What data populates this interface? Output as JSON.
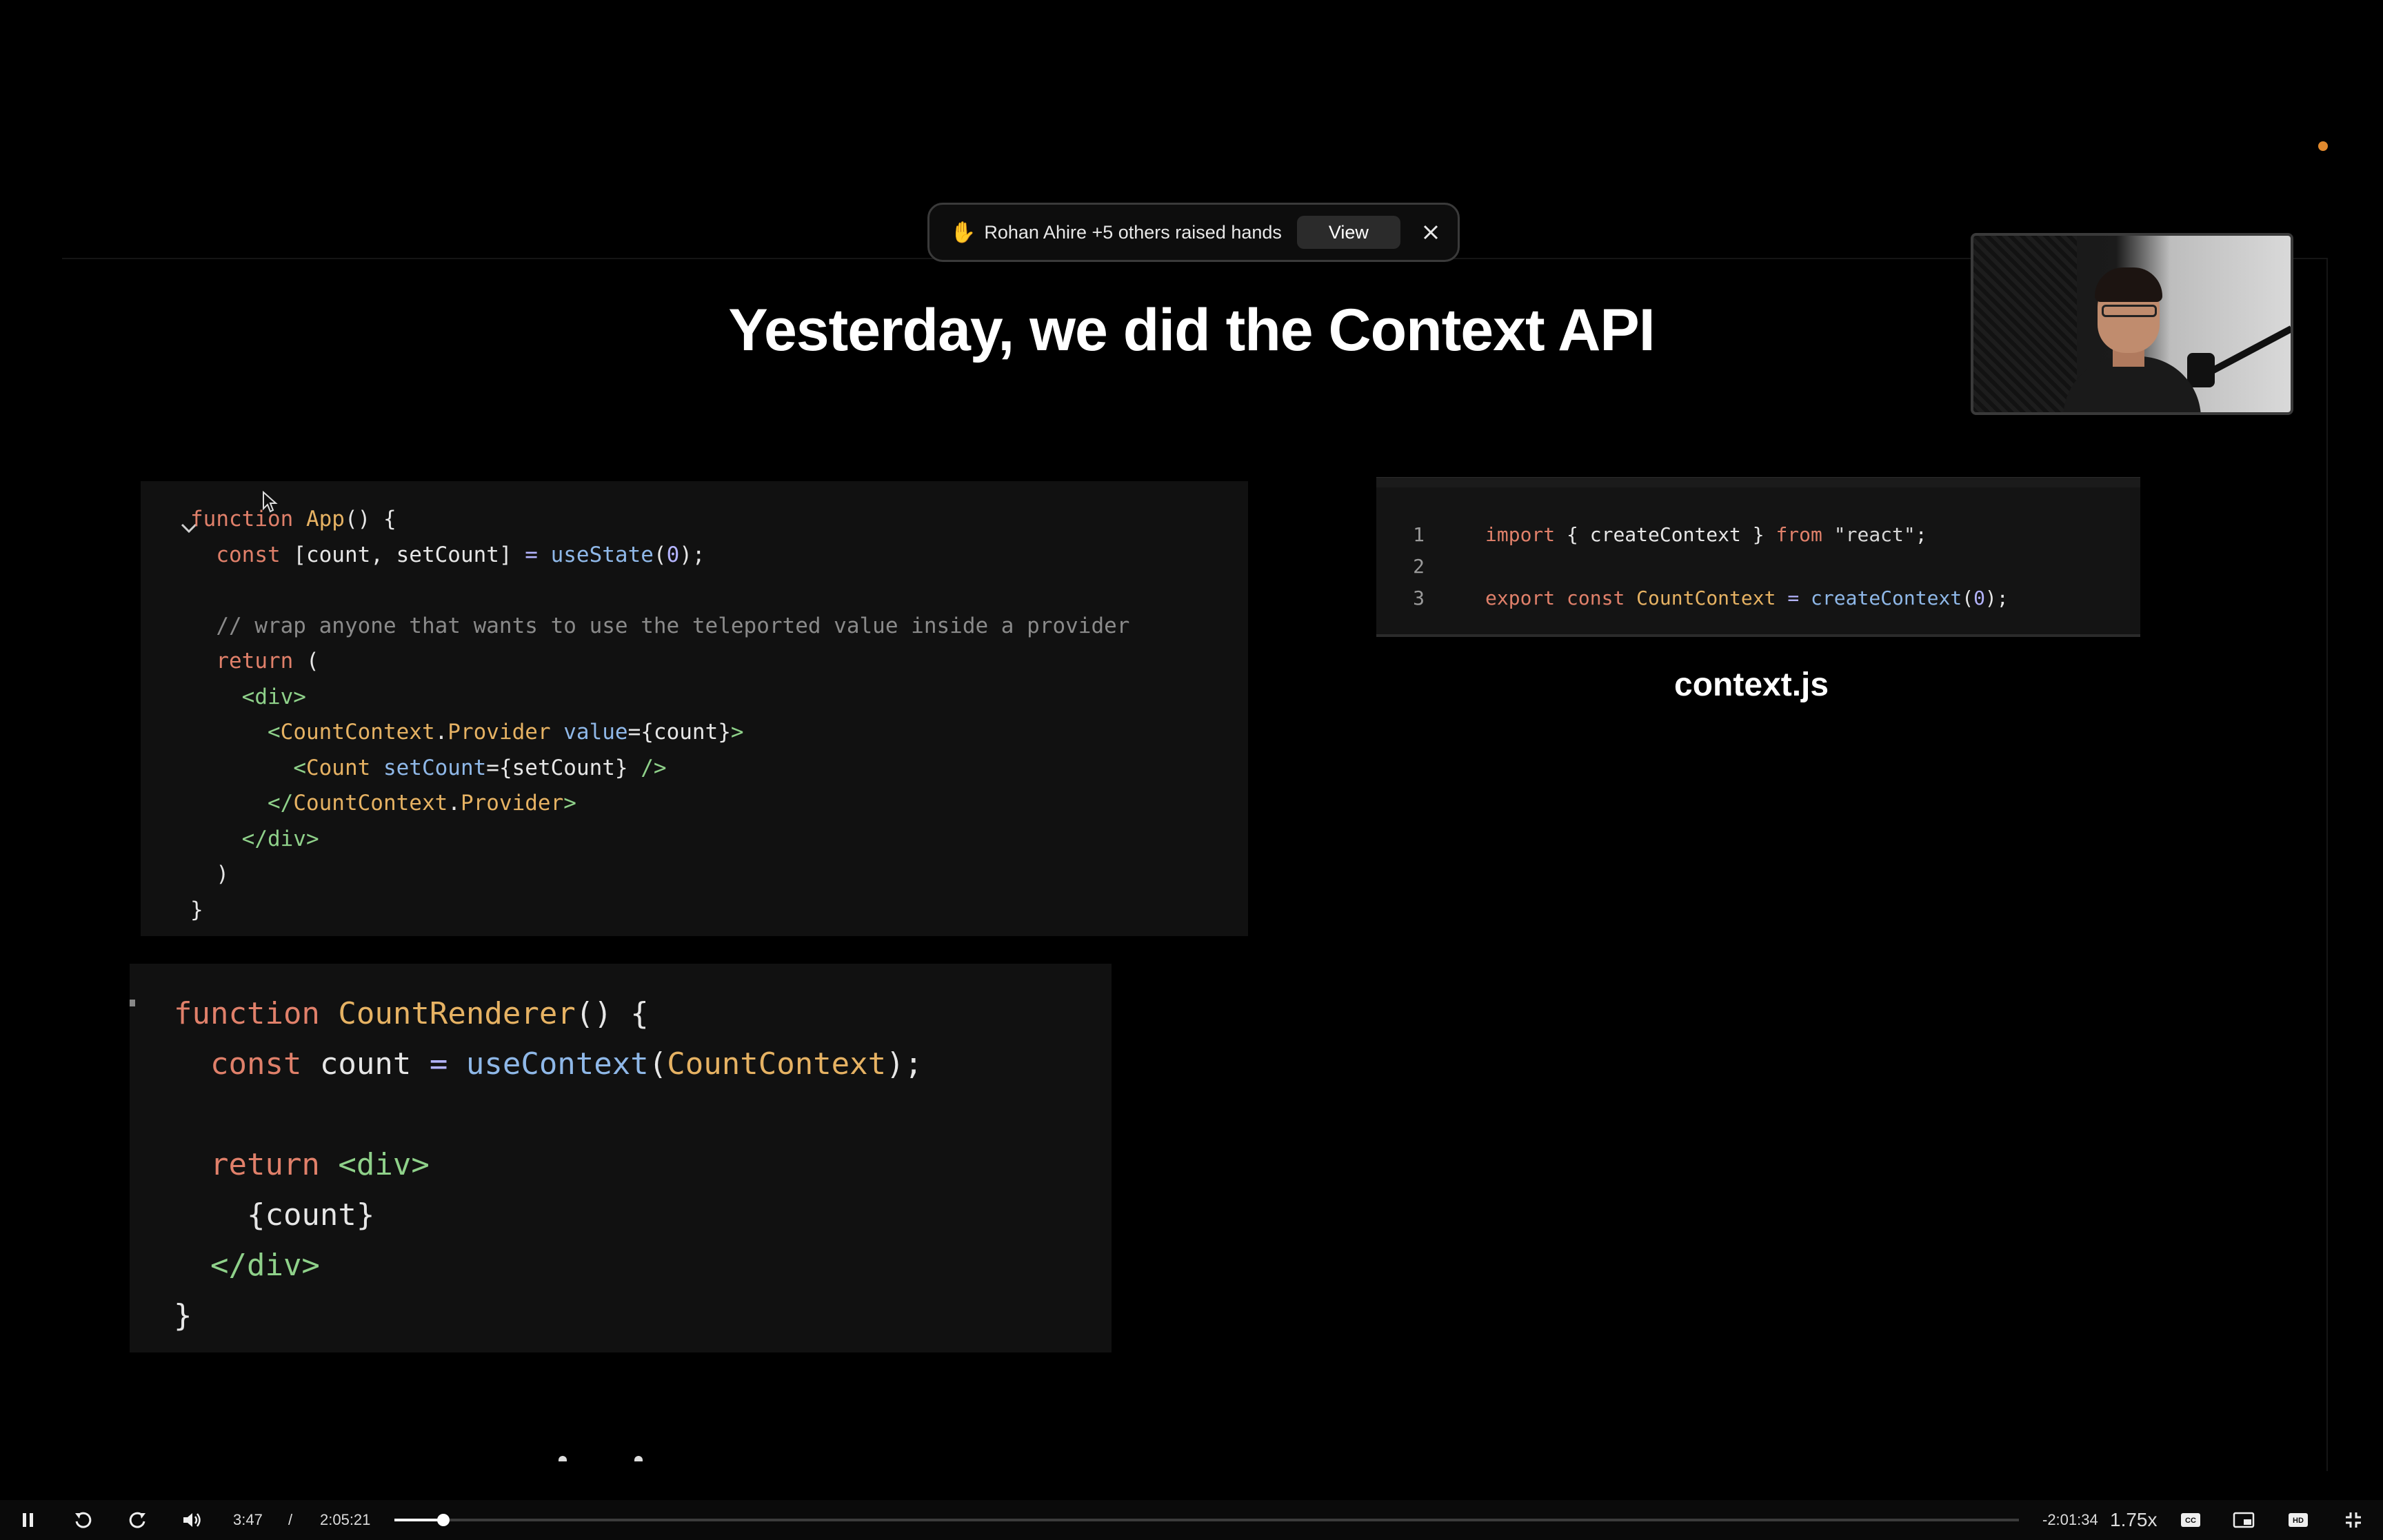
{
  "notification": {
    "message": "Rohan Ahire +5 others raised hands",
    "view_label": "View"
  },
  "slide": {
    "title": "Yesterday, we did the Context API",
    "context_caption": "context.js"
  },
  "code_app": [
    [
      {
        "t": "function ",
        "c": "kw"
      },
      {
        "t": "App",
        "c": "fn"
      },
      {
        "t": "() {",
        "c": "pl"
      }
    ],
    [
      {
        "t": "  const ",
        "c": "kw"
      },
      {
        "t": "[count, setCount] ",
        "c": "pl"
      },
      {
        "t": "= ",
        "c": "op"
      },
      {
        "t": "useState",
        "c": "attr"
      },
      {
        "t": "(",
        "c": "pl"
      },
      {
        "t": "0",
        "c": "num"
      },
      {
        "t": ");",
        "c": "pl"
      }
    ],
    [],
    [
      {
        "t": "  // wrap anyone that wants to use the teleported value inside a provider",
        "c": "cm"
      }
    ],
    [
      {
        "t": "  return ",
        "c": "kw"
      },
      {
        "t": "(",
        "c": "pl"
      }
    ],
    [
      {
        "t": "    ",
        "c": "pl"
      },
      {
        "t": "<div>",
        "c": "tag"
      }
    ],
    [
      {
        "t": "      ",
        "c": "pl"
      },
      {
        "t": "<",
        "c": "tag"
      },
      {
        "t": "CountContext",
        "c": "fn"
      },
      {
        "t": ".",
        "c": "pl"
      },
      {
        "t": "Provider",
        "c": "fn"
      },
      {
        "t": " value",
        "c": "attr"
      },
      {
        "t": "={count}",
        "c": "pl"
      },
      {
        "t": ">",
        "c": "tag"
      }
    ],
    [
      {
        "t": "        ",
        "c": "pl"
      },
      {
        "t": "<",
        "c": "tag"
      },
      {
        "t": "Count",
        "c": "fn"
      },
      {
        "t": " setCount",
        "c": "attr"
      },
      {
        "t": "={setCount} ",
        "c": "pl"
      },
      {
        "t": "/>",
        "c": "tag"
      }
    ],
    [
      {
        "t": "      ",
        "c": "pl"
      },
      {
        "t": "</",
        "c": "tag"
      },
      {
        "t": "CountContext",
        "c": "fn"
      },
      {
        "t": ".",
        "c": "pl"
      },
      {
        "t": "Provider",
        "c": "fn"
      },
      {
        "t": ">",
        "c": "tag"
      }
    ],
    [
      {
        "t": "    ",
        "c": "pl"
      },
      {
        "t": "</div>",
        "c": "tag"
      }
    ],
    [
      {
        "t": "  )",
        "c": "pl"
      }
    ],
    [
      {
        "t": "}",
        "c": "pl"
      }
    ]
  ],
  "code_context": {
    "line_numbers": [
      "1",
      "2",
      "3"
    ],
    "lines": [
      [
        {
          "t": "import ",
          "c": "kw"
        },
        {
          "t": "{ createContext } ",
          "c": "pl"
        },
        {
          "t": "from ",
          "c": "kw"
        },
        {
          "t": "\"react\"",
          "c": "str"
        },
        {
          "t": ";",
          "c": "pl"
        }
      ],
      [],
      [
        {
          "t": "export ",
          "c": "kw"
        },
        {
          "t": "const ",
          "c": "kw"
        },
        {
          "t": "CountContext ",
          "c": "fn"
        },
        {
          "t": "= ",
          "c": "op"
        },
        {
          "t": "createContext",
          "c": "attr"
        },
        {
          "t": "(",
          "c": "pl"
        },
        {
          "t": "0",
          "c": "num"
        },
        {
          "t": ");",
          "c": "pl"
        }
      ]
    ]
  },
  "code_countrenderer": [
    [
      {
        "t": "function ",
        "c": "kw"
      },
      {
        "t": "CountRenderer",
        "c": "fn"
      },
      {
        "t": "() {",
        "c": "pl"
      }
    ],
    [
      {
        "t": "  const ",
        "c": "kw"
      },
      {
        "t": "count ",
        "c": "pl"
      },
      {
        "t": "= ",
        "c": "op"
      },
      {
        "t": "useContext",
        "c": "attr"
      },
      {
        "t": "(",
        "c": "pl"
      },
      {
        "t": "CountContext",
        "c": "fn"
      },
      {
        "t": ");",
        "c": "pl"
      }
    ],
    [],
    [
      {
        "t": "  return ",
        "c": "kw"
      },
      {
        "t": "<div>",
        "c": "tag"
      }
    ],
    [
      {
        "t": "    {count}",
        "c": "pl"
      }
    ],
    [
      {
        "t": "  ",
        "c": "pl"
      },
      {
        "t": "</div>",
        "c": "tag"
      }
    ],
    [
      {
        "t": "}",
        "c": "pl"
      }
    ]
  ],
  "player": {
    "current_time": "3:47",
    "separator": "/",
    "total_time": "2:05:21",
    "remaining_time": "-2:01:34",
    "speed": "1.75x",
    "progress_fraction": 0.03,
    "icons": [
      "pause-icon",
      "rewind-icon",
      "forward-icon",
      "volume-icon",
      "captions-icon",
      "pip-icon",
      "hd-icon",
      "exit-fullscreen-icon"
    ]
  }
}
